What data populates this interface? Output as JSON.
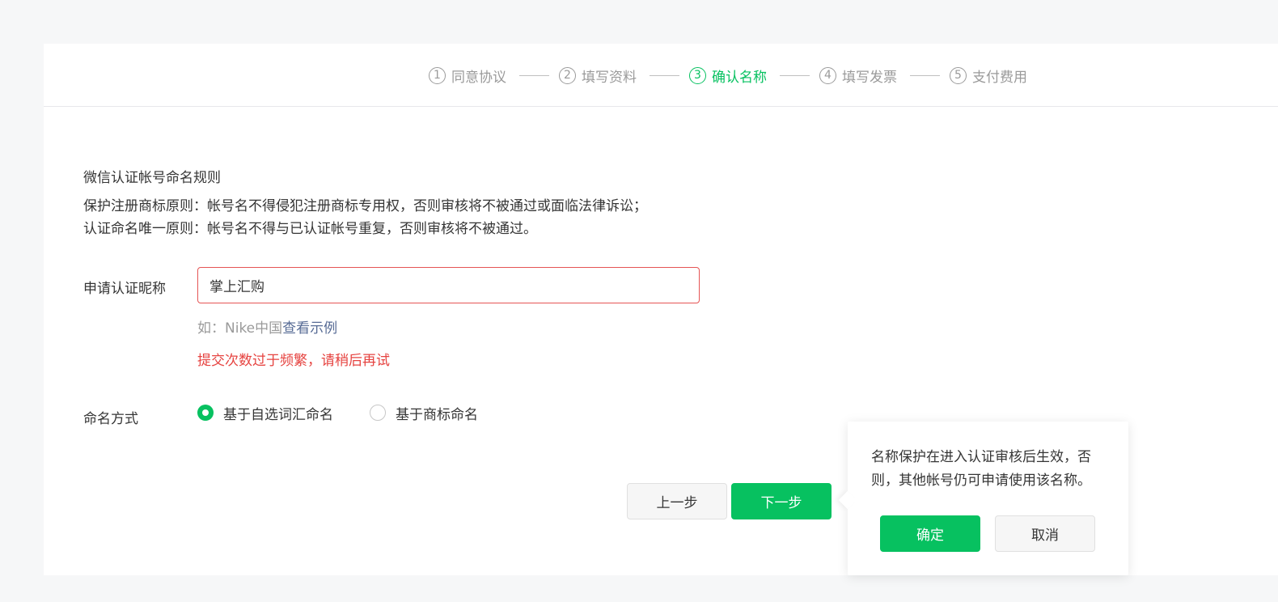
{
  "steps": [
    {
      "num": "1",
      "label": "同意协议",
      "active": false
    },
    {
      "num": "2",
      "label": "填写资料",
      "active": false
    },
    {
      "num": "3",
      "label": "确认名称",
      "active": true
    },
    {
      "num": "4",
      "label": "填写发票",
      "active": false
    },
    {
      "num": "5",
      "label": "支付费用",
      "active": false
    }
  ],
  "rules": {
    "title": "微信认证帐号命名规则",
    "lines": [
      "保护注册商标原则：帐号名不得侵犯注册商标专用权，否则审核将不被通过或面临法律诉讼；",
      "认证命名唯一原则：帐号名不得与已认证帐号重复，否则审核将不被通过。"
    ]
  },
  "nickname": {
    "label": "申请认证昵称",
    "value": "掌上汇购",
    "hint_prefix": "如：Nike中国",
    "hint_link": "查看示例",
    "error": "提交次数过于频繁，请稍后再试"
  },
  "naming": {
    "label": "命名方式",
    "options": [
      {
        "label": "基于自选词汇命名",
        "checked": true
      },
      {
        "label": "基于商标命名",
        "checked": false
      }
    ]
  },
  "actions": {
    "prev_label": "上一步",
    "next_label": "下一步"
  },
  "popover": {
    "text": "名称保护在进入认证审核后生效，否则，其他帐号仍可申请使用该名称。",
    "confirm_label": "确定",
    "cancel_label": "取消"
  },
  "colors": {
    "accent": "#07c160",
    "error": "#e64340",
    "link": "#576b95"
  }
}
